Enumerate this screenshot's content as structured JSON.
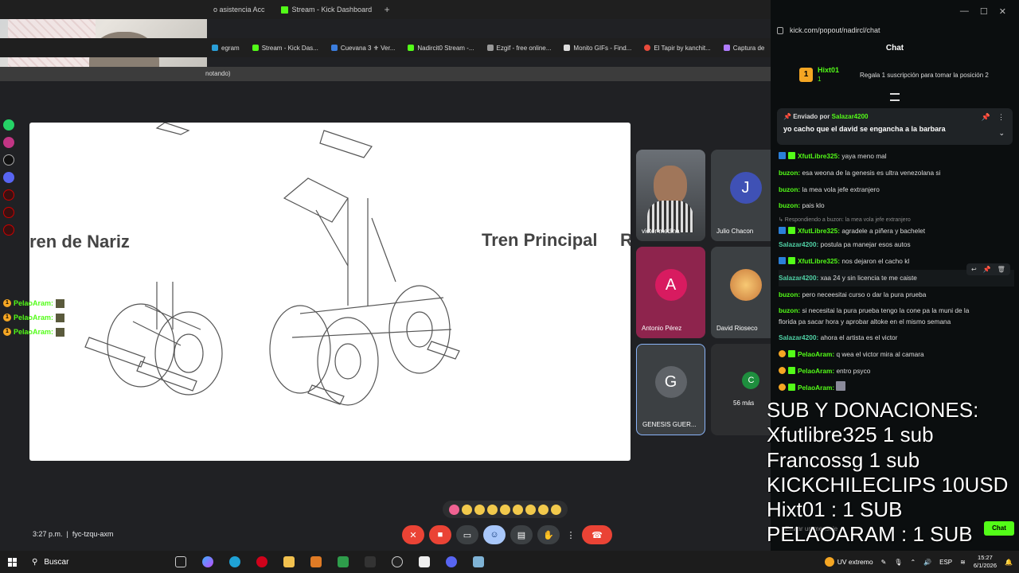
{
  "browser": {
    "tabs": [
      {
        "label": "o asistencia Acc"
      },
      {
        "label": "Stream - Kick Dashboard"
      }
    ],
    "new_tab": "+",
    "bookmarks": [
      {
        "label": "egram",
        "color": "#2a9fd8"
      },
      {
        "label": "Stream - Kick Das...",
        "color": "#53fc18"
      },
      {
        "label": "Cuevana 3 ⚜ Ver...",
        "color": "#3b7ddd"
      },
      {
        "label": "Nadircit0 Stream -...",
        "color": "#53fc18"
      },
      {
        "label": "Ezgif - free online...",
        "color": "#999999"
      },
      {
        "label": "Monito GIFs - Find...",
        "color": "#dddddd"
      },
      {
        "label": "El Tapir by kanchit...",
        "color": "#e94b3c"
      },
      {
        "label": "Captura de",
        "color": "#b07cff"
      }
    ],
    "infobar": "notando)"
  },
  "slide": {
    "left_label": "ren de Nariz",
    "right_label": "Tren Principal",
    "cut_label": "R"
  },
  "overlay_chat": [
    {
      "user": "PelaoAram:",
      "badge": "1"
    },
    {
      "user": "PelaoAram:",
      "badge": "1"
    },
    {
      "user": "PelaoAram:",
      "badge": "1"
    }
  ],
  "participants": [
    {
      "name": "victor medina",
      "avatar": "",
      "color": "#4a4a4a"
    },
    {
      "name": "Julio Chacon",
      "avatar": "J",
      "color": "#3f51b5"
    },
    {
      "name": "Antonio Pérez",
      "avatar": "A",
      "color": "#d81b60"
    },
    {
      "name": "David Rioseco",
      "avatar": "",
      "color": "#f4a340"
    },
    {
      "name": "GENESIS GUER...",
      "avatar": "G",
      "color": "#5f6368"
    },
    {
      "name": "56 más",
      "avatar": "C",
      "color": "#1e8e3e"
    }
  ],
  "meeting": {
    "time": "3:27 p.m.",
    "code": "fyc-tzqu-axm"
  },
  "chat_window": {
    "url": "kick.com/popout/nadircl/chat",
    "title": "Chat",
    "top_gifter": {
      "name": "Hixt01",
      "count": "1",
      "rank": "1"
    },
    "gift_prompt": "Regala 1 suscripción para tomar la posición 2",
    "pinned": {
      "sent_by": "Enviado por",
      "user": "Salazar4200",
      "text": "yo cacho que el david se engancha a la barbara"
    },
    "messages": [
      {
        "user": "XfutLibre325:",
        "text": "yaya meno mal",
        "color": "#53fc18",
        "badges": true
      },
      {
        "user": "buzon:",
        "text": "esa weona de la genesis es ultra venezolana si",
        "color": "#53fc18"
      },
      {
        "user": "buzon:",
        "text": "la mea vola jefe extranjero",
        "color": "#53fc18"
      },
      {
        "user": "buzon:",
        "text": "pais klo",
        "color": "#53fc18"
      },
      {
        "reply": "↳ Respondiendo a buzon: la mea vola jefe extranjero"
      },
      {
        "user": "XfutLibre325:",
        "text": "agradele a piñera y bachelet",
        "color": "#53fc18",
        "badges": true
      },
      {
        "user": "Salazar4200:",
        "text": "postula pa manejar esos autos",
        "color": "#4fd1a5"
      },
      {
        "user": "XfutLibre325:",
        "text": "nos dejaron el cacho kl",
        "color": "#53fc18",
        "badges": true
      },
      {
        "user": "Salazar4200:",
        "text": "xaa 24 y sin licencia te me caiste",
        "color": "#4fd1a5"
      },
      {
        "user": "buzon:",
        "text": "pero neceesitai curso o dar la pura prueba",
        "color": "#53fc18"
      },
      {
        "user": "buzon:",
        "text": "si necesitai la pura prueba tengo la cone pa la muni de la",
        "color": "#53fc18"
      },
      {
        "text": "florida pa sacar hora y aprobar altoke en el mismo semana"
      },
      {
        "user": "Salazar4200:",
        "text": "ahora el artista es el victor",
        "color": "#4fd1a5"
      },
      {
        "user": "PelaoAram:",
        "text": "q wea el victor mira al camara",
        "color": "#53fc18",
        "badges": true
      },
      {
        "user": "PelaoAram:",
        "text": "entro psyco",
        "color": "#53fc18",
        "badges": true
      },
      {
        "user": "PelaoAram:",
        "text": "",
        "color": "#53fc18",
        "badges": true
      }
    ],
    "input_placeholder": "Enviar un mensaje",
    "chat_button": "Chat"
  },
  "donations_overlay": [
    "SUB Y DONACIONES:",
    "Xfutlibre325 1 sub",
    "Francossg 1 sub",
    "KICKCHILECLIPS 10USD",
    "Hixt01 : 1 SUB",
    "PELAOARAM : 1 SUB"
  ],
  "taskbar": {
    "search": "Buscar",
    "weather": "UV extremo",
    "lang": "ESP",
    "time": "15:27",
    "date": "6/1/2026"
  }
}
